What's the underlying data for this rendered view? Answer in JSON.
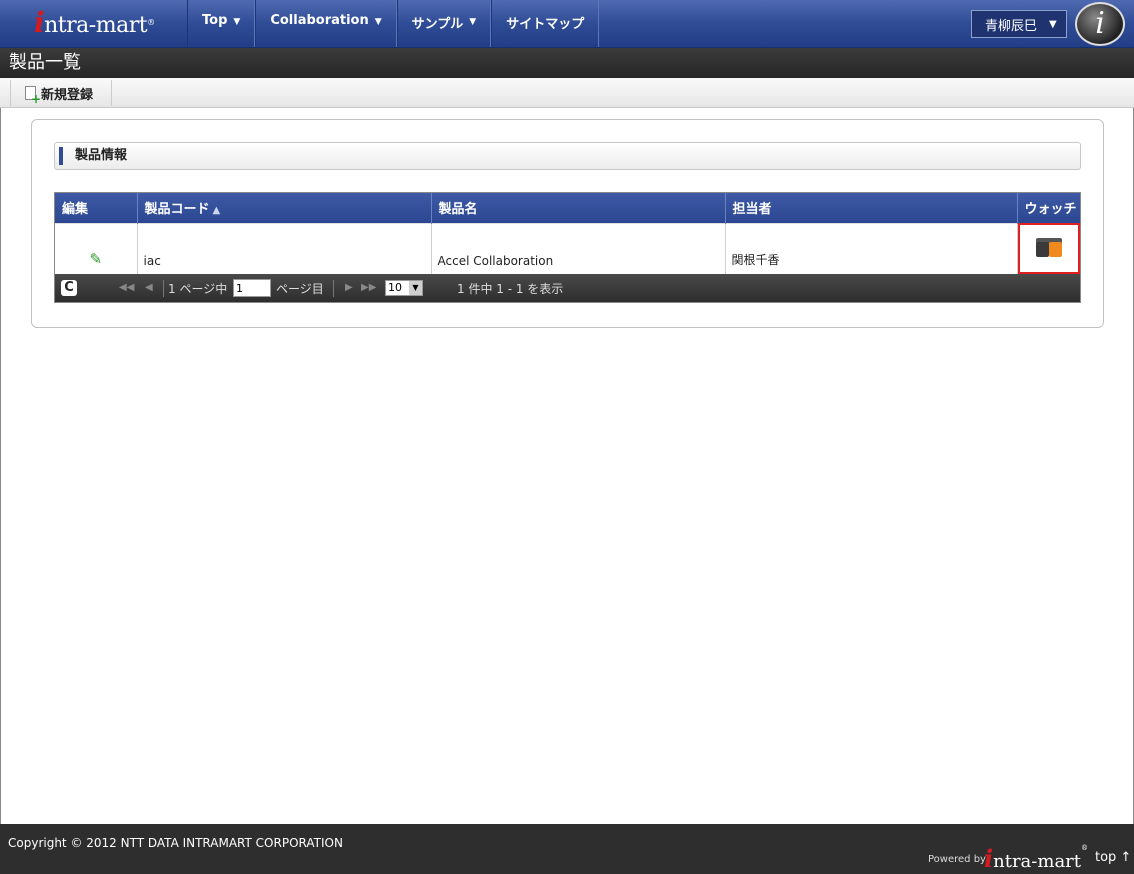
{
  "header": {
    "logo_text": "ntra-mart",
    "logo_initial": "i",
    "menu": [
      {
        "label": "Top",
        "caret": "▼"
      },
      {
        "label": "Collaboration",
        "caret": "▼"
      },
      {
        "label": "サンプル",
        "caret": "▼"
      },
      {
        "label": "サイトマップ",
        "caret": ""
      }
    ],
    "user_name": "青柳辰巳",
    "user_caret": "▼",
    "badge_letter": "i"
  },
  "page_title": "製品一覧",
  "toolbar": {
    "new_label": "新規登録"
  },
  "section": {
    "title": "製品情報"
  },
  "grid": {
    "columns": [
      "編集",
      "製品コード",
      "製品名",
      "担当者",
      "ウォッチ"
    ],
    "sort_indicator": "▲",
    "rows": [
      {
        "code": "iac",
        "name": "Accel Collaboration",
        "owner": "関根千香"
      }
    ]
  },
  "pager": {
    "refresh": "C",
    "first": "◀◀",
    "prev": "◀",
    "page_prefix": "1 ページ中",
    "page_value": "1",
    "page_suffix": "ページ目",
    "next": "▶",
    "last": "▶▶",
    "page_size": "10",
    "summary": "1 件中 1 - 1 を表示"
  },
  "footer": {
    "copyright": "Copyright © 2012 NTT DATA INTRAMART CORPORATION",
    "powered_by": "Powered by",
    "logo_text": "ntra-mart",
    "logo_initial": "i",
    "top_link": "top ↑"
  },
  "colors": {
    "nav_blue": "#2f4c96",
    "watch_highlight": "#e02020",
    "edit_green": "#2c9a2c"
  }
}
